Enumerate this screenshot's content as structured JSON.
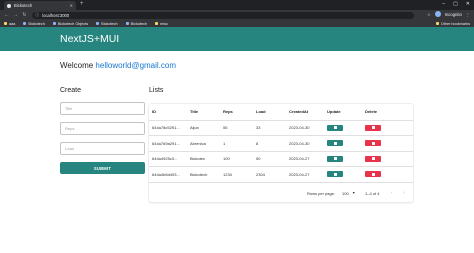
{
  "browser": {
    "tab_title": "Bickotech",
    "new_tab_symbol": "+",
    "url_scheme": "ⓘ",
    "url_host": "localhost:3000",
    "profile_name": "Incognito",
    "bookmarks": [
      {
        "label": "aaa",
        "kind": "folder"
      },
      {
        "label": "Bickotech",
        "kind": "link"
      },
      {
        "label": "Bickotech Objects",
        "kind": "link"
      },
      {
        "label": "Bickotech",
        "kind": "link"
      },
      {
        "label": "Bickotech",
        "kind": "link"
      },
      {
        "label": "misc",
        "kind": "folder"
      }
    ],
    "other_bookmarks": "Other bookmarks"
  },
  "app": {
    "title": "NextJS+MUI",
    "welcome_prefix": "Welcome ",
    "email": "helloworld@gmail.com"
  },
  "create": {
    "heading": "Create",
    "fields": [
      {
        "placeholder": "Title"
      },
      {
        "placeholder": "Reps"
      },
      {
        "placeholder": "Load"
      }
    ],
    "submit_label": "SUBMIT"
  },
  "lists": {
    "heading": "Lists",
    "columns": [
      "ID",
      "Title",
      "Reps",
      "Load",
      "CreatedAt",
      "Update",
      "Delete"
    ],
    "rows": [
      {
        "id": "644a78c5291...",
        "title": "Aljun",
        "reps": "55",
        "load": "33",
        "createdAt": "2023-04-30"
      },
      {
        "id": "644a769a291...",
        "title": "Abrenica",
        "reps": "1",
        "load": "8",
        "createdAt": "2023-04-30"
      },
      {
        "id": "644a4925c3...",
        "title": "Bickotec",
        "reps": "100",
        "load": "50",
        "createdAt": "2023-04-27"
      },
      {
        "id": "644a4b6d493...",
        "title": "Bickotech",
        "reps": "1234",
        "load": "2304",
        "createdAt": "2023-04-27"
      }
    ],
    "pagination": {
      "rows_per_page_label": "Rows per page:",
      "rows_per_page_value": "100",
      "range_text": "1–4 of 4"
    }
  },
  "colors": {
    "primary": "#26867f",
    "danger": "#e8334a",
    "link": "#1976d2"
  }
}
